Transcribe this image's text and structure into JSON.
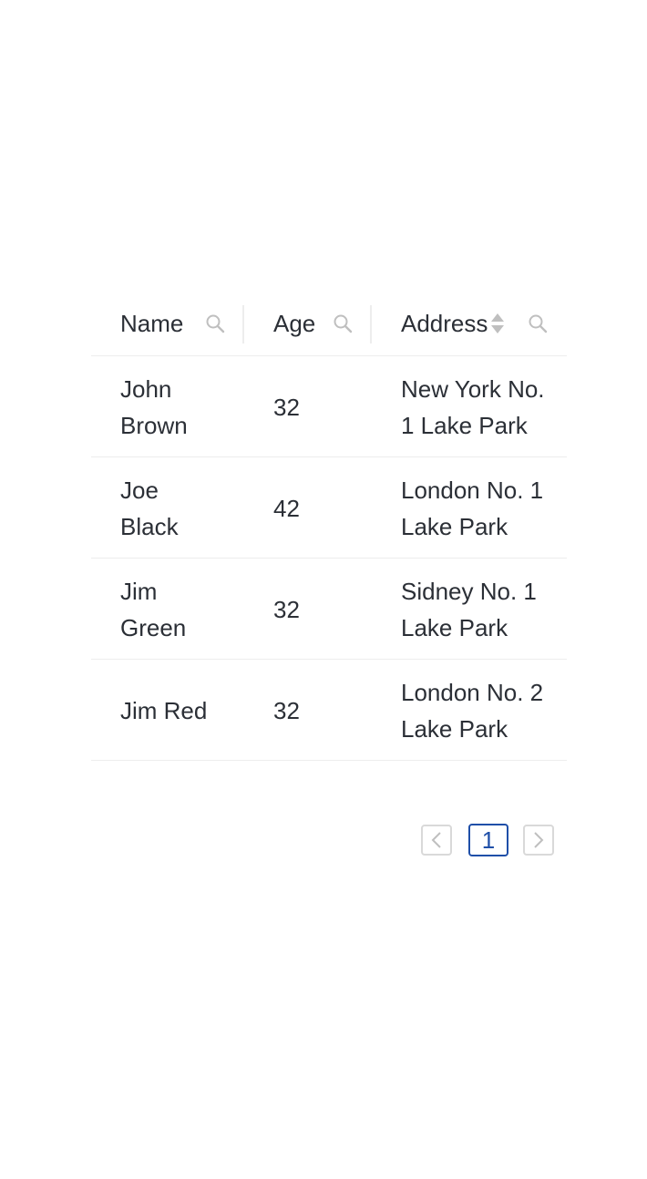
{
  "table": {
    "columns": [
      {
        "title": "Name",
        "has_search": true,
        "has_sorter": false
      },
      {
        "title": "Age",
        "has_search": true,
        "has_sorter": false
      },
      {
        "title": "Address",
        "has_search": true,
        "has_sorter": true
      }
    ],
    "rows": [
      {
        "name": "John Brown",
        "age": "32",
        "address": "New York No. 1 Lake Park"
      },
      {
        "name": "Joe Black",
        "age": "42",
        "address": "London No. 1 Lake Park"
      },
      {
        "name": "Jim Green",
        "age": "32",
        "address": "Sidney No. 1 Lake Park"
      },
      {
        "name": "Jim Red",
        "age": "32",
        "address": "London No. 2 Lake Park"
      }
    ]
  },
  "pagination": {
    "current_page": "1",
    "prev_icon": "chevron-left-icon",
    "next_icon": "chevron-right-icon"
  },
  "colors": {
    "text": "#2b2f36",
    "border": "#ededed",
    "icon": "#bfbfbf",
    "accent": "#1f4fa8"
  }
}
